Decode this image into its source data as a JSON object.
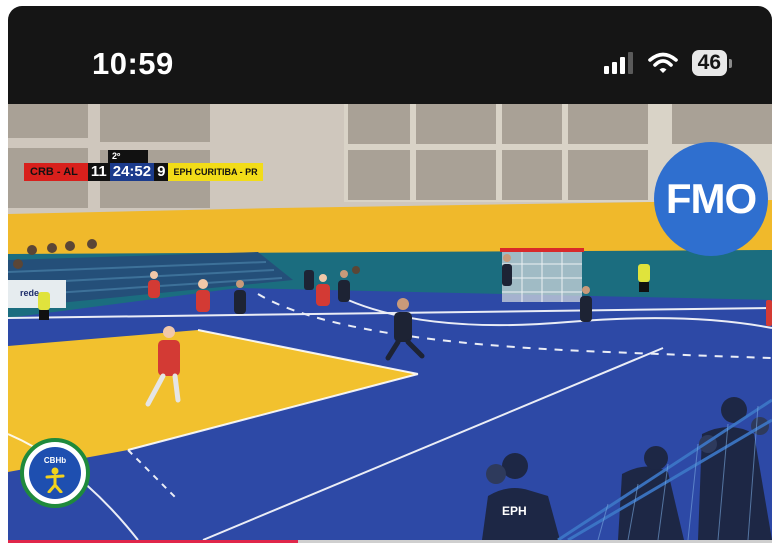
{
  "status_bar": {
    "time": "10:59",
    "battery_level": "46",
    "icons": [
      "cellular-signal-icon",
      "wifi-icon",
      "battery-icon"
    ]
  },
  "video": {
    "scorebug": {
      "period": "2º TEMPO",
      "home_team": "CRB - AL",
      "home_score": "11",
      "clock": "24:52",
      "away_score": "9",
      "away_team": "EPH CURITIBA - PR"
    },
    "logos": {
      "fmo": "FMO",
      "cbhb": "CBHb"
    },
    "banner_text": "rede",
    "shirt_text": "EPH"
  },
  "progress": {
    "fraction": 0.38
  },
  "colors": {
    "status_bar_bg": "#151515",
    "court_blue": "#2d49a6",
    "court_yellow": "#f2c12e",
    "wall_teal": "#1b6d7f",
    "home_red": "#d8201c",
    "away_yellow": "#f2dc18",
    "fmo_blue": "#2f6fcf",
    "progress_red": "#e0264a"
  }
}
